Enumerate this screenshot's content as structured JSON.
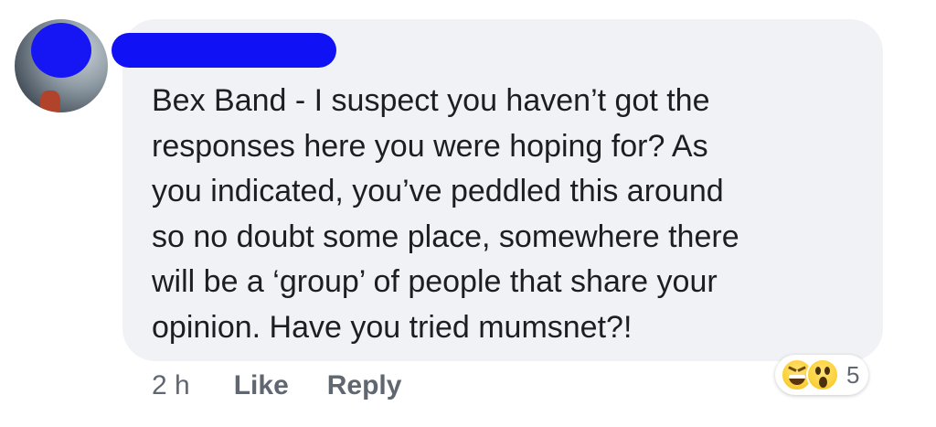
{
  "comment": {
    "text": "Bex Band - I suspect you haven’t got the\nresponses here you were hoping for? As\nyou indicated, you’ve peddled this around\nso no doubt some place, somewhere there\nwill be a ‘group’ of people that share your\nopinion. Have you tried mumsnet?!",
    "timestamp": "2 h",
    "like_label": "Like",
    "reply_label": "Reply",
    "reactions": {
      "icons": [
        "haha-icon",
        "wow-icon"
      ],
      "count": "5"
    }
  },
  "colors": {
    "bubble": "#f1f2f5",
    "text": "#1c1e21",
    "meta": "#606770",
    "redaction": "#1111f5"
  }
}
